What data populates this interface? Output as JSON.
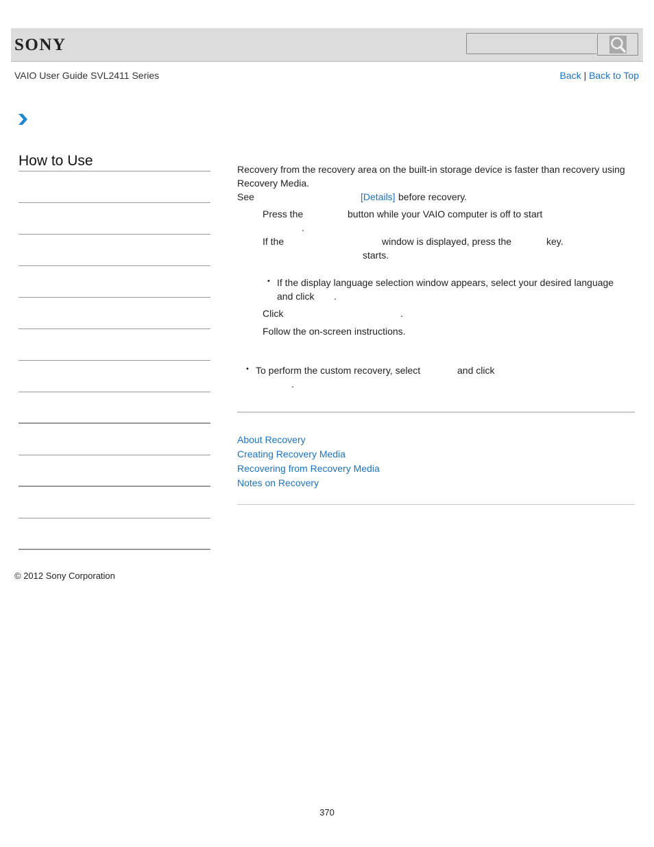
{
  "header": {
    "logo_text": "SONY",
    "search": {
      "placeholder": "",
      "value": "",
      "button_icon": "search-icon"
    }
  },
  "subheader": {
    "guide_title": "VAIO User Guide SVL2411 Series",
    "back_label": "Back",
    "separator": "|",
    "back_to_top_label": "Back to Top"
  },
  "breadcrumb": {
    "icon": "chevron-right-icon"
  },
  "sidebar": {
    "title": "How to Use",
    "item_count": 12
  },
  "main": {
    "intro_line1": "Recovery from the recovery area on the built-in storage device is faster than recovery using",
    "intro_line2": "Recovery Media.",
    "see_prefix": "See",
    "details_link": "[Details]",
    "see_suffix": "before recovery.",
    "step1_a": "Press the",
    "step1_b": "button while your VAIO computer is off to start",
    "step1_c": ".",
    "step2_a": "If the",
    "step2_b": "window is displayed, press the",
    "step2_c": "key.",
    "step2_d": "starts.",
    "step2_note_line1": "If the display language selection window appears, select your desired language",
    "step2_note_line2_a": "and click",
    "step2_note_line2_b": ".",
    "step3_a": "Click",
    "step3_b": ".",
    "step4": "Follow the on-screen instructions.",
    "hint_a": "To perform the custom recovery, select",
    "hint_b": "and click",
    "hint_c": "."
  },
  "related_links": [
    "About Recovery",
    "Creating Recovery Media",
    "Recovering from Recovery Media",
    "Notes on Recovery"
  ],
  "footer": {
    "copyright": "© 2012 Sony Corporation",
    "page_number": "370"
  },
  "colors": {
    "link": "#1a73c4",
    "header_bg": "#dcdcdc",
    "chevron": "#1e88d0"
  }
}
